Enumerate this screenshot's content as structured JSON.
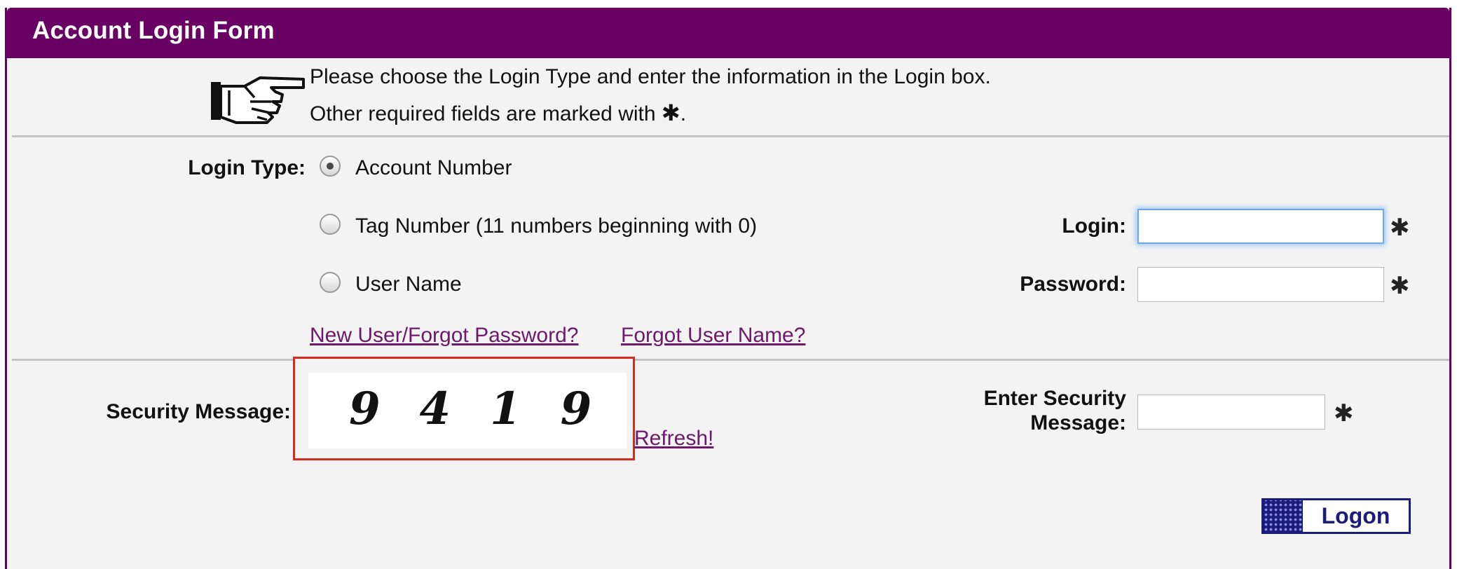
{
  "header": {
    "title": "Account Login Form"
  },
  "intro": {
    "icon": "pointing-hand-icon",
    "line1": "Please choose the Login Type and enter the information in the Login box.",
    "line2": "Other required fields are marked with ",
    "line2_end": "."
  },
  "required_marker": "✱",
  "login_type": {
    "label": "Login Type:",
    "options": [
      {
        "label": "Account Number",
        "selected": true
      },
      {
        "label": "Tag Number (11 numbers beginning with 0)",
        "selected": false
      },
      {
        "label": "User Name",
        "selected": false
      }
    ]
  },
  "login": {
    "label": "Login:",
    "value": ""
  },
  "password": {
    "label": "Password:",
    "value": ""
  },
  "links": {
    "new_user": "New User/Forgot Password?",
    "forgot_username": "Forgot User Name?"
  },
  "security": {
    "label": "Security Message:",
    "captcha": "9419",
    "refresh": "Refresh!",
    "enter_label_line1": "Enter Security",
    "enter_label_line2": "Message:",
    "value": ""
  },
  "logon_button": {
    "label": "Logon"
  },
  "colors": {
    "header": "#690063",
    "link": "#6d1a6a",
    "highlight_border": "#d32d1e",
    "button": "#1b1b7a",
    "focus": "#6fa7e8"
  }
}
